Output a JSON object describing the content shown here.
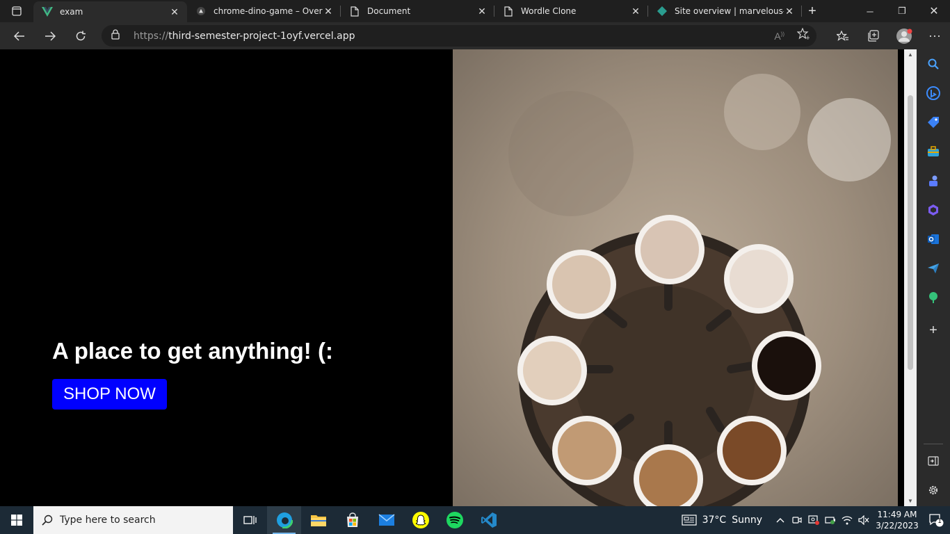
{
  "browser": {
    "tabs": [
      {
        "title": "exam",
        "favicon": "vue-icon",
        "active": true
      },
      {
        "title": "chrome-dino-game – Overvie",
        "favicon": "vercel-icon",
        "active": false
      },
      {
        "title": "Document",
        "favicon": "document-icon",
        "active": false
      },
      {
        "title": "Wordle Clone",
        "favicon": "document-icon",
        "active": false
      },
      {
        "title": "Site overview | marvelous-em",
        "favicon": "netlify-icon",
        "active": false
      }
    ],
    "url_prefix": "https://",
    "url_host": "third-semester-project-1oyf.vercel.app"
  },
  "page": {
    "headline": "A place to get anything! (:",
    "cta_label": "SHOP NOW",
    "cta_color": "#0000ff"
  },
  "taskbar": {
    "search_placeholder": "Type here to search",
    "weather_temp": "37°C",
    "weather_desc": "Sunny",
    "time": "11:49 AM",
    "date": "3/22/2023",
    "notification_count": "1"
  }
}
